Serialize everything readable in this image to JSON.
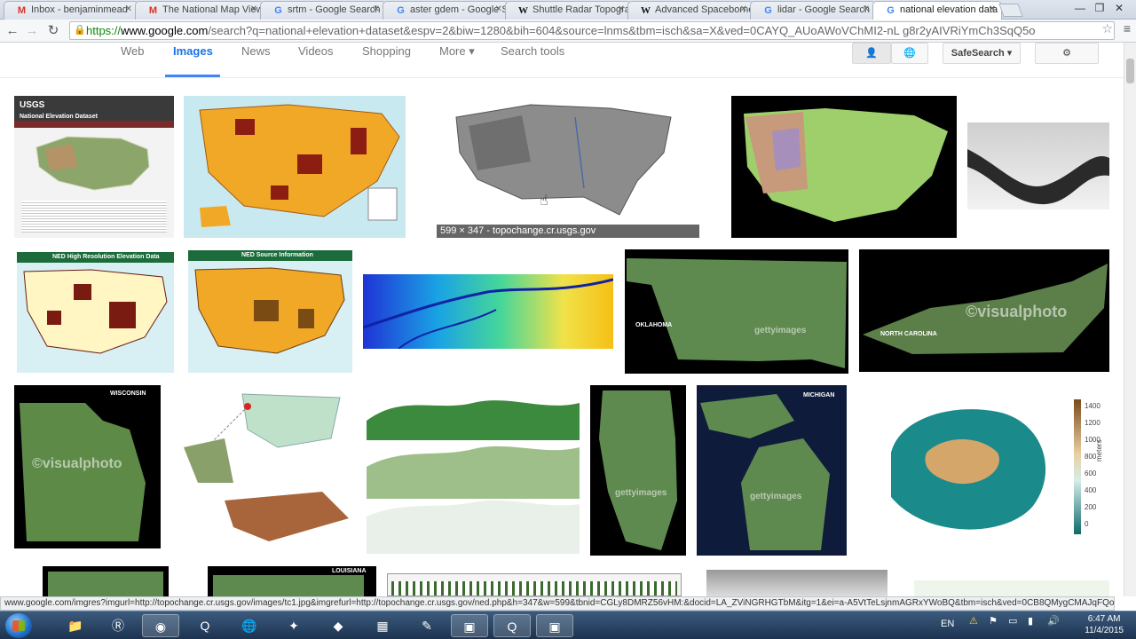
{
  "tabs": [
    {
      "title": "Inbox - benjaminmead",
      "icon": "gmail-icon",
      "active": false
    },
    {
      "title": "The National Map View",
      "icon": "gmail-icon",
      "active": false
    },
    {
      "title": "srtm - Google Search",
      "icon": "google-icon",
      "active": false
    },
    {
      "title": "aster gdem - Google S",
      "icon": "google-icon",
      "active": false
    },
    {
      "title": "Shuttle Radar Topogra",
      "icon": "wikipedia-icon",
      "active": false
    },
    {
      "title": "Advanced Spaceborne",
      "icon": "wikipedia-icon",
      "active": false
    },
    {
      "title": "lidar - Google Search",
      "icon": "google-icon",
      "active": false
    },
    {
      "title": "national elevation data",
      "icon": "google-icon",
      "active": true
    }
  ],
  "address": {
    "scheme": "https://",
    "host": "www.google.com",
    "path": "/search?q=national+elevation+dataset&espv=2&biw=1280&bih=604&source=lnms&tbm=isch&sa=X&ved=0CAYQ_AUoAWoVChMI2-nL g8r2yAIVRiYmCh3SqQ5o"
  },
  "nav": {
    "web": "Web",
    "images": "Images",
    "news": "News",
    "videos": "Videos",
    "shopping": "Shopping",
    "more": "More ▾",
    "search_tools": "Search tools",
    "safesearch": "SafeSearch ▾"
  },
  "results": {
    "hover_caption": "599 × 347 - topochange.cr.usgs.gov",
    "labels": {
      "usgs": "USGS",
      "ned_title": "National Elevation Dataset",
      "ned_hr": "NED High Resolution Elevation Data",
      "ned_source": "NED Source Information",
      "oklahoma": "OKLAHOMA",
      "north_carolina": "NORTH CAROLINA",
      "wisconsin": "WISCONSIN",
      "michigan": "MICHIGAN",
      "louisiana": "LOUISIANA",
      "getty": "gettyimages",
      "visualphoto": "©visualphoto"
    },
    "colorbar": {
      "ticks": [
        "1400",
        "1200",
        "1000",
        "800",
        "600",
        "400",
        "200",
        "0"
      ],
      "unit": "meters"
    }
  },
  "status_url": "www.google.com/imgres?imgurl=http://topochange.cr.usgs.gov/images/tc1.jpg&imgrefurl=http://topochange.cr.usgs.gov/ned.php&h=347&w=599&tbnid=CGLy8DMRZ56vHM:&docid=LA_ZViNGRHGTbM&itg=1&ei=a-A5VtTeLsjnmAGRxYWoBQ&tbm=isch&ved=0CB8QMygCMAJqFQoTCJTAk...",
  "taskbar": {
    "apps": [
      "explorer-icon",
      "r-icon",
      "chrome-icon",
      "qgis-icon",
      "globe-icon",
      "network-icon",
      "arcgis-icon",
      "calculator-icon",
      "paint-icon",
      "app-icon",
      "qgis-icon",
      "app-icon"
    ],
    "lang": "EN",
    "time": "6:47 AM",
    "date": "11/4/2015"
  },
  "colors": {
    "accent": "#4285f4",
    "https_green": "#0a8a0a"
  }
}
